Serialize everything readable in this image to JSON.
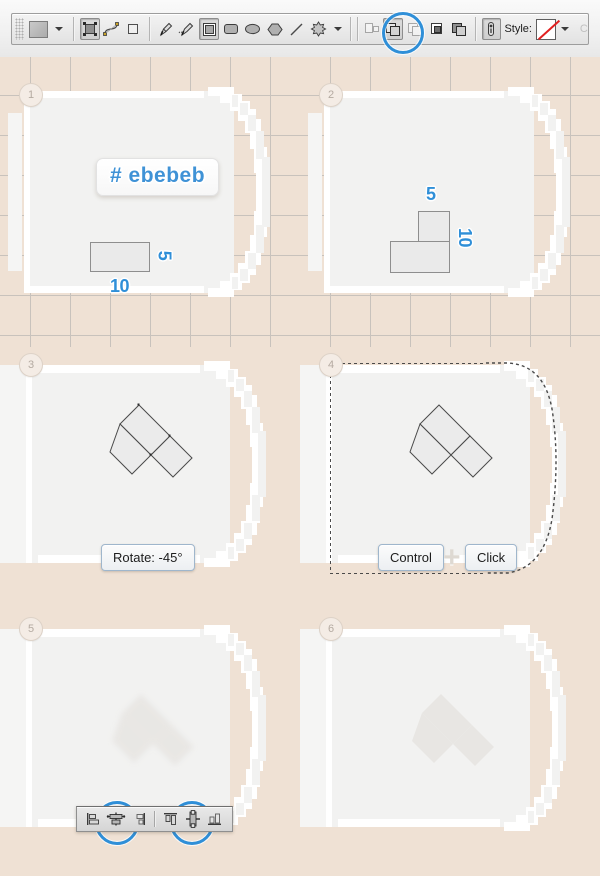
{
  "toolbar": {
    "style_label": "Style:",
    "tail_char": "C",
    "icons": [
      {
        "name": "grip-handle"
      },
      {
        "name": "fill-color-swatch"
      },
      {
        "name": "tool-preset-caret"
      },
      {
        "name": "shape-layer-icon"
      },
      {
        "name": "path-icon"
      },
      {
        "name": "fill-pixels-icon"
      },
      {
        "name": "pen-tool-icon"
      },
      {
        "name": "freeform-pen-icon"
      },
      {
        "name": "rectangle-tool-icon"
      },
      {
        "name": "rounded-rectangle-tool-icon"
      },
      {
        "name": "ellipse-tool-icon"
      },
      {
        "name": "polygon-tool-icon"
      },
      {
        "name": "line-tool-icon"
      },
      {
        "name": "custom-shape-tool-icon"
      },
      {
        "name": "geometry-options-caret"
      },
      {
        "name": "create-new-shape-layer-icon"
      },
      {
        "name": "add-to-shape-area-icon"
      },
      {
        "name": "subtract-from-shape-area-icon"
      },
      {
        "name": "intersect-shape-areas-icon"
      },
      {
        "name": "exclude-overlapping-shape-areas-icon"
      },
      {
        "name": "layer-style-icon"
      },
      {
        "name": "no-style-swatch"
      },
      {
        "name": "style-picker-caret"
      }
    ],
    "highlight": {
      "target": "add-to-shape-area-icon"
    }
  },
  "accent_color": "#2f8fd8",
  "canvas_color": "#efe1d4",
  "panels": [
    {
      "step": "1",
      "grid": true,
      "hex_label": "# ebebeb",
      "dim_width": "10",
      "dim_height": "5"
    },
    {
      "step": "2",
      "grid": true,
      "dim_width": "10",
      "dim_height": "5"
    },
    {
      "step": "3",
      "grid": false,
      "rotate_label": "Rotate: -45°"
    },
    {
      "step": "4",
      "grid": false,
      "key_left": "Control",
      "key_plus": "+",
      "key_right": "Click"
    },
    {
      "step": "5",
      "grid": false,
      "align_toolbar": {
        "buttons": [
          {
            "name": "align-left-edges-icon",
            "highlighted": false
          },
          {
            "name": "align-horizontal-centers-icon",
            "highlighted": true
          },
          {
            "name": "align-right-edges-icon",
            "highlighted": false
          },
          {
            "name": "align-top-edges-icon",
            "highlighted": false
          },
          {
            "name": "align-vertical-centers-icon",
            "highlighted": true
          },
          {
            "name": "align-bottom-edges-icon",
            "highlighted": false
          }
        ]
      }
    },
    {
      "step": "6",
      "grid": false
    }
  ]
}
